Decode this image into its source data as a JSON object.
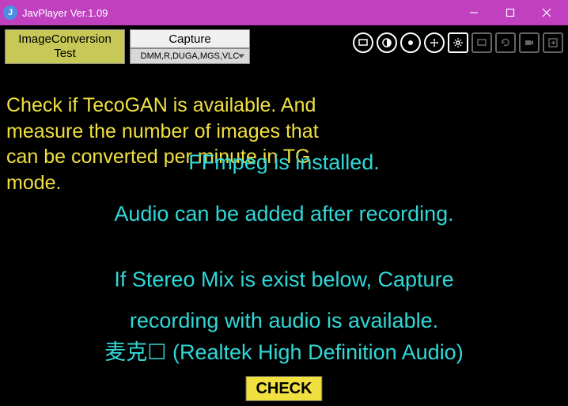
{
  "window": {
    "title": "JavPlayer Ver.1.09",
    "app_icon_letter": "J"
  },
  "toolbar": {
    "convert_label": "ImageConversion\nTest",
    "capture_label": "Capture",
    "dropdown_value": "DMM,R,DUGA,MGS,VLC"
  },
  "messages": {
    "yellow": "Check if TecoGAN is available. And measure the number of images that can be converted per minute in TG mode.",
    "cyan_ffmpeg": "FFmpeg is installed.",
    "cyan_audio": "Audio can be added after recording.",
    "cyan_stereo1": "If Stereo Mix is exist below, Capture",
    "cyan_stereo2": "recording with audio is available.",
    "cyan_device": "麦克☐ (Realtek High Definition Audio)"
  },
  "buttons": {
    "check": "CHECK"
  }
}
